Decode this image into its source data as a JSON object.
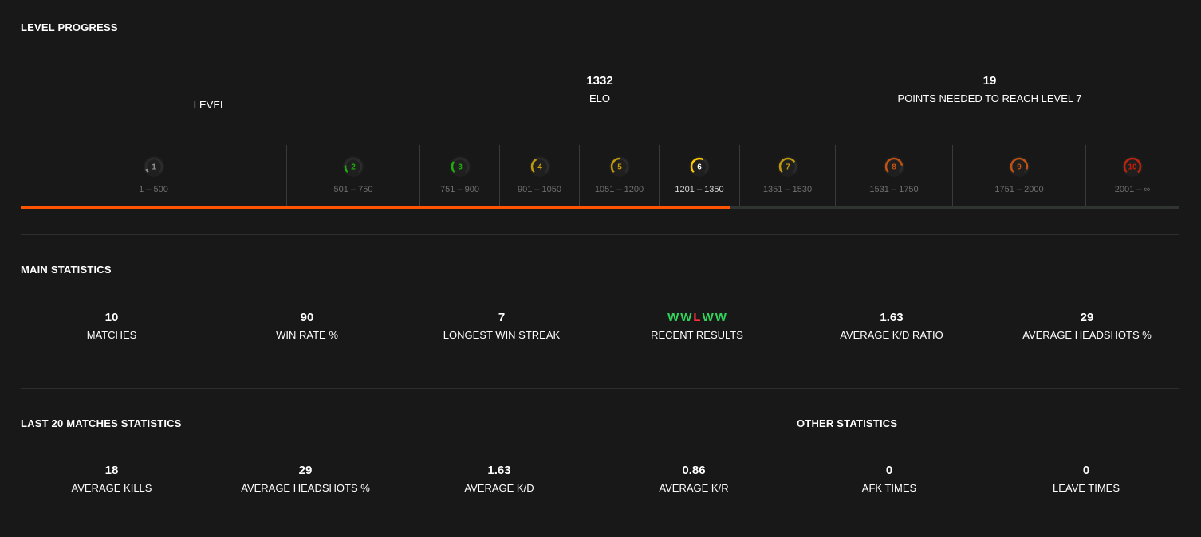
{
  "level_progress": {
    "title": "LEVEL PROGRESS",
    "level_label": "LEVEL",
    "elo_value": "1332",
    "elo_label": "ELO",
    "points_value": "19",
    "points_label": "POINTS NEEDED TO REACH LEVEL 7",
    "progress_fraction": 0.613,
    "current_level": 6,
    "levels": [
      {
        "number": "1",
        "range": "1 – 500",
        "color": "#b9b9b9",
        "fill": 0.1
      },
      {
        "number": "2",
        "range": "501 – 750",
        "color": "#1ce400",
        "fill": 0.2
      },
      {
        "number": "3",
        "range": "751 – 900",
        "color": "#1ce400",
        "fill": 0.3
      },
      {
        "number": "4",
        "range": "901 – 1050",
        "color": "#ffc800",
        "fill": 0.4
      },
      {
        "number": "5",
        "range": "1051 – 1200",
        "color": "#ffc800",
        "fill": 0.5
      },
      {
        "number": "6",
        "range": "1201 – 1350",
        "color": "#ffc800",
        "fill": 0.6
      },
      {
        "number": "7",
        "range": "1351 – 1530",
        "color": "#ffc800",
        "fill": 0.7
      },
      {
        "number": "8",
        "range": "1531 – 1750",
        "color": "#ff6309",
        "fill": 0.8
      },
      {
        "number": "9",
        "range": "1751 – 2000",
        "color": "#ff6309",
        "fill": 0.9
      },
      {
        "number": "10",
        "range": "2001 – ∞",
        "color": "#fe1f00",
        "fill": 1.0
      }
    ]
  },
  "main_statistics": {
    "title": "MAIN STATISTICS",
    "matches": {
      "value": "10",
      "label": "MATCHES"
    },
    "win_rate": {
      "value": "90",
      "label": "WIN RATE %"
    },
    "longest_streak": {
      "value": "7",
      "label": "LONGEST WIN STREAK"
    },
    "recent_results": {
      "results": [
        "W",
        "W",
        "L",
        "W",
        "W"
      ],
      "label": "RECENT RESULTS"
    },
    "kd_ratio": {
      "value": "1.63",
      "label": "AVERAGE K/D RATIO"
    },
    "headshots": {
      "value": "29",
      "label": "AVERAGE HEADSHOTS %"
    }
  },
  "last20": {
    "title": "LAST 20 MATCHES STATISTICS",
    "kills": {
      "value": "18",
      "label": "AVERAGE KILLS"
    },
    "headshots": {
      "value": "29",
      "label": "AVERAGE HEADSHOTS %"
    },
    "kd": {
      "value": "1.63",
      "label": "AVERAGE K/D"
    },
    "kr": {
      "value": "0.86",
      "label": "AVERAGE K/R"
    }
  },
  "other": {
    "title": "OTHER STATISTICS",
    "afk": {
      "value": "0",
      "label": "AFK TIMES"
    },
    "leave": {
      "value": "0",
      "label": "LEAVE TIMES"
    }
  },
  "colors": {
    "accent": "#ff5500",
    "win": "#32d35a",
    "loss": "#ff2f3f",
    "background": "#181818"
  }
}
